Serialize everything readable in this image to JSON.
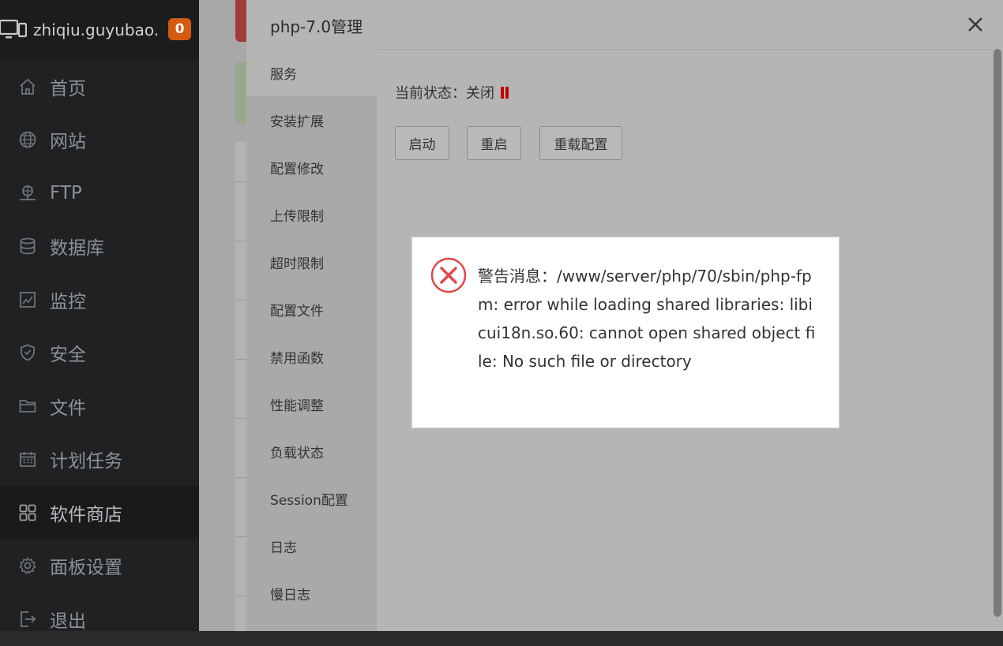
{
  "sidebar": {
    "host": "zhiqiu.guyubao.c",
    "badge": "0",
    "items": [
      {
        "label": "首页",
        "icon": "home-icon"
      },
      {
        "label": "网站",
        "icon": "globe-icon"
      },
      {
        "label": "FTP",
        "icon": "ftp-icon"
      },
      {
        "label": "数据库",
        "icon": "database-icon"
      },
      {
        "label": "监控",
        "icon": "monitor-icon"
      },
      {
        "label": "安全",
        "icon": "shield-icon"
      },
      {
        "label": "文件",
        "icon": "folder-icon"
      },
      {
        "label": "计划任务",
        "icon": "calendar-icon"
      },
      {
        "label": "软件商店",
        "icon": "apps-icon",
        "active": true
      },
      {
        "label": "面板设置",
        "icon": "gear-icon"
      },
      {
        "label": "退出",
        "icon": "logout-icon"
      }
    ]
  },
  "modal": {
    "title": "php-7.0管理",
    "tabs": [
      {
        "label": "服务",
        "active": true
      },
      {
        "label": "安装扩展"
      },
      {
        "label": "配置修改"
      },
      {
        "label": "上传限制"
      },
      {
        "label": "超时限制"
      },
      {
        "label": "配置文件"
      },
      {
        "label": "禁用函数"
      },
      {
        "label": "性能调整"
      },
      {
        "label": "负载状态"
      },
      {
        "label": "Session配置"
      },
      {
        "label": "日志"
      },
      {
        "label": "慢日志"
      }
    ],
    "status_label": "当前状态：",
    "status_value": "关闭",
    "buttons": {
      "start": "启动",
      "restart": "重启",
      "reload": "重载配置"
    }
  },
  "alert": {
    "message": "警告消息：/www/server/php/70/sbin/php-fpm: error while loading shared libraries: libicui18n.so.60: cannot open shared object file: No such file or directory"
  },
  "colors": {
    "sidebar_bg": "#202122",
    "badge": "#d45a10",
    "status_paused": "#c00000",
    "error_icon": "#e0484a"
  }
}
